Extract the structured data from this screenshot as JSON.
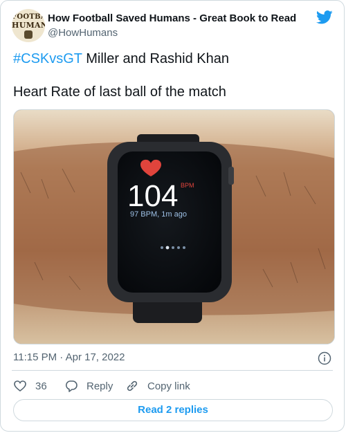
{
  "author": {
    "name": "How Football Saved Humans - Great Book to Read",
    "handle": "@HowHumans",
    "avatar_text_top": "FOOTBALL",
    "avatar_text_bottom": "HUMANS"
  },
  "tweet": {
    "hashtag": "#CSKvsGT",
    "line1_rest": " Miller and Rashid Khan",
    "line2": "Heart Rate of last ball of the match",
    "timestamp": "11:15 PM · Apr 17, 2022"
  },
  "photo": {
    "bpm_value": "104",
    "bpm_unit": "BPM",
    "bpm_sub": "97 BPM, 1m ago"
  },
  "actions": {
    "like_count": "36",
    "reply_label": "Reply",
    "copy_label": "Copy link",
    "read_replies_label": "Read 2 replies"
  },
  "colors": {
    "accent": "#1d9bf0",
    "text": "#0f1419",
    "muted": "#536471",
    "heart": "#e0443c"
  },
  "icons": [
    "twitter-bird-icon",
    "heart-icon",
    "reply-icon",
    "link-icon",
    "info-icon"
  ]
}
